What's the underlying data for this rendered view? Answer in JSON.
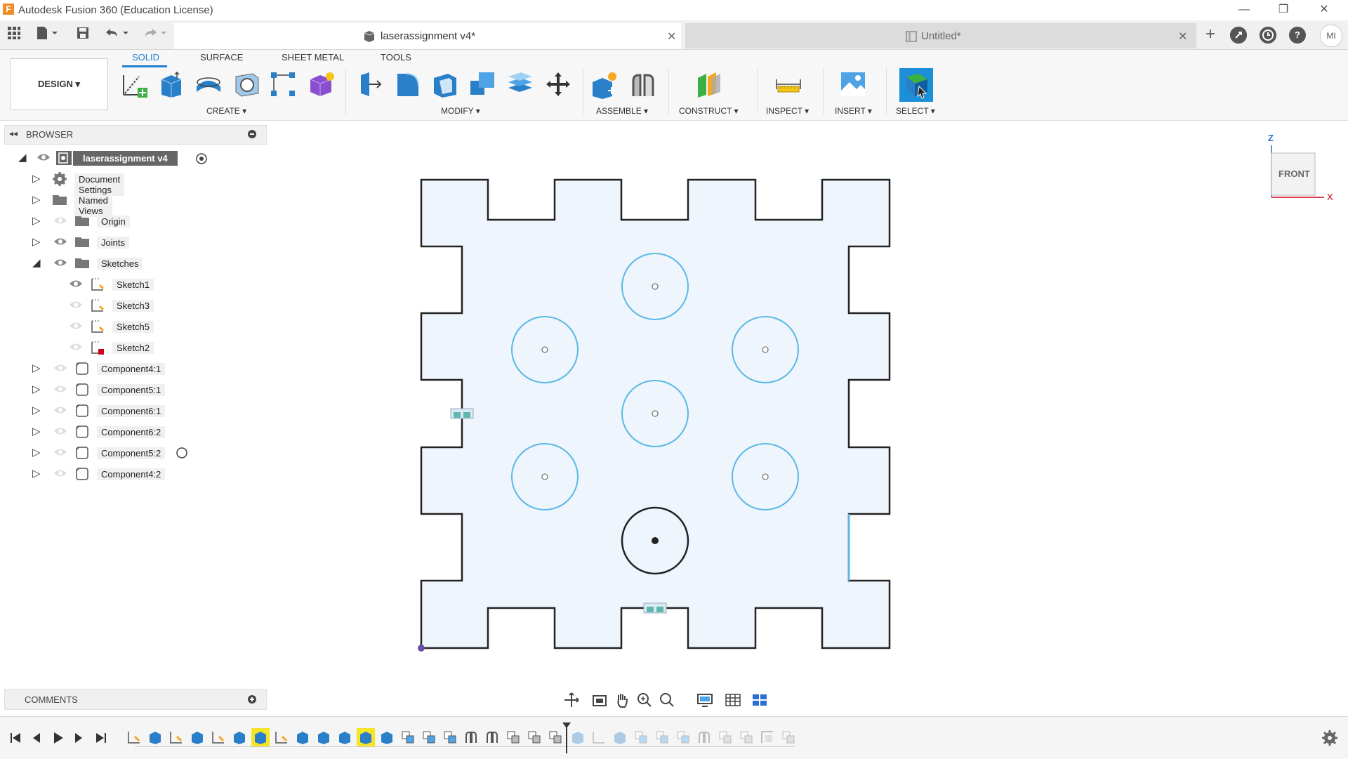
{
  "window": {
    "title": "Autodesk Fusion 360 (Education License)",
    "app_logo_letter": "F",
    "controls": {
      "minimize": "—",
      "restore": "❐",
      "close": "✕"
    }
  },
  "tabs": [
    {
      "label": "laserassignment v4*",
      "active": true,
      "close": "✕"
    },
    {
      "label": "Untitled*",
      "active": false,
      "close": "✕"
    }
  ],
  "tab_actions": {
    "add": "+",
    "user_initials": "MI",
    "help": "?"
  },
  "workspace": {
    "label": "DESIGN ▾"
  },
  "ribbon_tabs": [
    "SOLID",
    "SURFACE",
    "SHEET METAL",
    "TOOLS"
  ],
  "ribbon_groups": {
    "create": "CREATE ▾",
    "modify": "MODIFY ▾",
    "assemble": "ASSEMBLE ▾",
    "construct": "CONSTRUCT ▾",
    "inspect": "INSPECT ▾",
    "insert": "INSERT ▾",
    "select": "SELECT ▾"
  },
  "browser": {
    "title": "BROWSER",
    "root": "laserassignment v4",
    "items": [
      {
        "label": "Document Settings",
        "icon": "gear-icon"
      },
      {
        "label": "Named Views",
        "icon": "folder-icon"
      },
      {
        "label": "Origin",
        "icon": "folder-icon"
      },
      {
        "label": "Joints",
        "icon": "folder-icon"
      },
      {
        "label": "Sketches",
        "icon": "folder-icon"
      },
      {
        "label": "Sketch1",
        "icon": "sketch-icon"
      },
      {
        "label": "Sketch3",
        "icon": "sketch-icon"
      },
      {
        "label": "Sketch5",
        "icon": "sketch-icon"
      },
      {
        "label": "Sketch2",
        "icon": "sketch-error-icon"
      },
      {
        "label": "Component4:1",
        "icon": "component-icon"
      },
      {
        "label": "Component5:1",
        "icon": "component-icon"
      },
      {
        "label": "Component6:1",
        "icon": "component-icon"
      },
      {
        "label": "Component6:2",
        "icon": "component-icon"
      },
      {
        "label": "Component5:2",
        "icon": "component-icon"
      },
      {
        "label": "Component4:2",
        "icon": "component-icon"
      }
    ]
  },
  "comments": {
    "title": "COMMENTS"
  },
  "viewcube": {
    "face": "FRONT",
    "axis_z": "Z",
    "axis_x": "X"
  },
  "colors": {
    "accent": "#1f7fd0",
    "sketch_fill": "#eef5fc",
    "sketch_curve": "#5bb8e6",
    "timeline_highlight": "#f5e526"
  }
}
